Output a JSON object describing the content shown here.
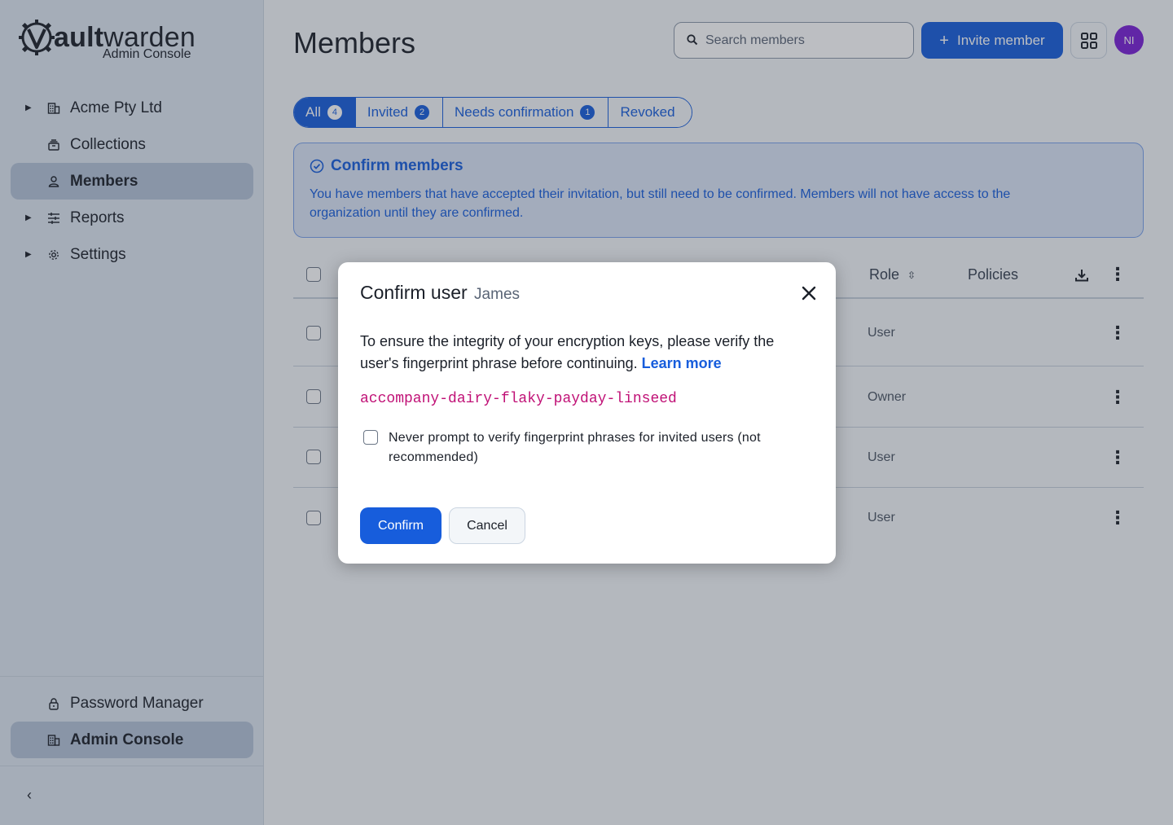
{
  "brand": {
    "name_bold": "V",
    "name_a": "ault",
    "name_b": "warden",
    "subtitle": "Admin Console"
  },
  "sidebar": {
    "items": [
      {
        "label": "Acme Pty Ltd",
        "icon": "building-icon",
        "expandable": true
      },
      {
        "label": "Collections",
        "icon": "collections-icon",
        "expandable": false
      },
      {
        "label": "Members",
        "icon": "user-icon",
        "expandable": false,
        "active": true
      },
      {
        "label": "Reports",
        "icon": "sliders-icon",
        "expandable": true
      },
      {
        "label": "Settings",
        "icon": "gear-icon",
        "expandable": true
      }
    ],
    "footer": [
      {
        "label": "Password Manager",
        "icon": "lock-icon"
      },
      {
        "label": "Admin Console",
        "icon": "building-icon",
        "active": true
      }
    ]
  },
  "header": {
    "title": "Members",
    "search_placeholder": "Search members",
    "invite_label": "Invite member",
    "avatar_initials": "NI"
  },
  "tabs": [
    {
      "label": "All",
      "count": "4",
      "active": true
    },
    {
      "label": "Invited",
      "count": "2"
    },
    {
      "label": "Needs confirmation",
      "count": "1"
    },
    {
      "label": "Revoked"
    }
  ],
  "callout": {
    "title": "Confirm members",
    "body": "You have members that have accepted their invitation, but still need to be confirmed. Members will not have access to the organization until they are confirmed."
  },
  "table": {
    "headers": {
      "role": "Role",
      "policies": "Policies"
    },
    "rows": [
      {
        "role": "User"
      },
      {
        "role": "Owner"
      },
      {
        "role": "User"
      },
      {
        "role": "User"
      }
    ]
  },
  "dialog": {
    "title": "Confirm user",
    "subtitle": "James",
    "body": "To ensure the integrity of your encryption keys, please verify the user's fingerprint phrase before continuing.",
    "learn_more": "Learn more",
    "fingerprint": "accompany-dairy-flaky-payday-linseed",
    "checkbox_label": "Never prompt to verify fingerprint phrases for invited users (not recommended)",
    "confirm_label": "Confirm",
    "cancel_label": "Cancel"
  },
  "colors": {
    "primary": "#175ddc",
    "fingerprint": "#c01176",
    "avatar": "#7a1fd6"
  }
}
